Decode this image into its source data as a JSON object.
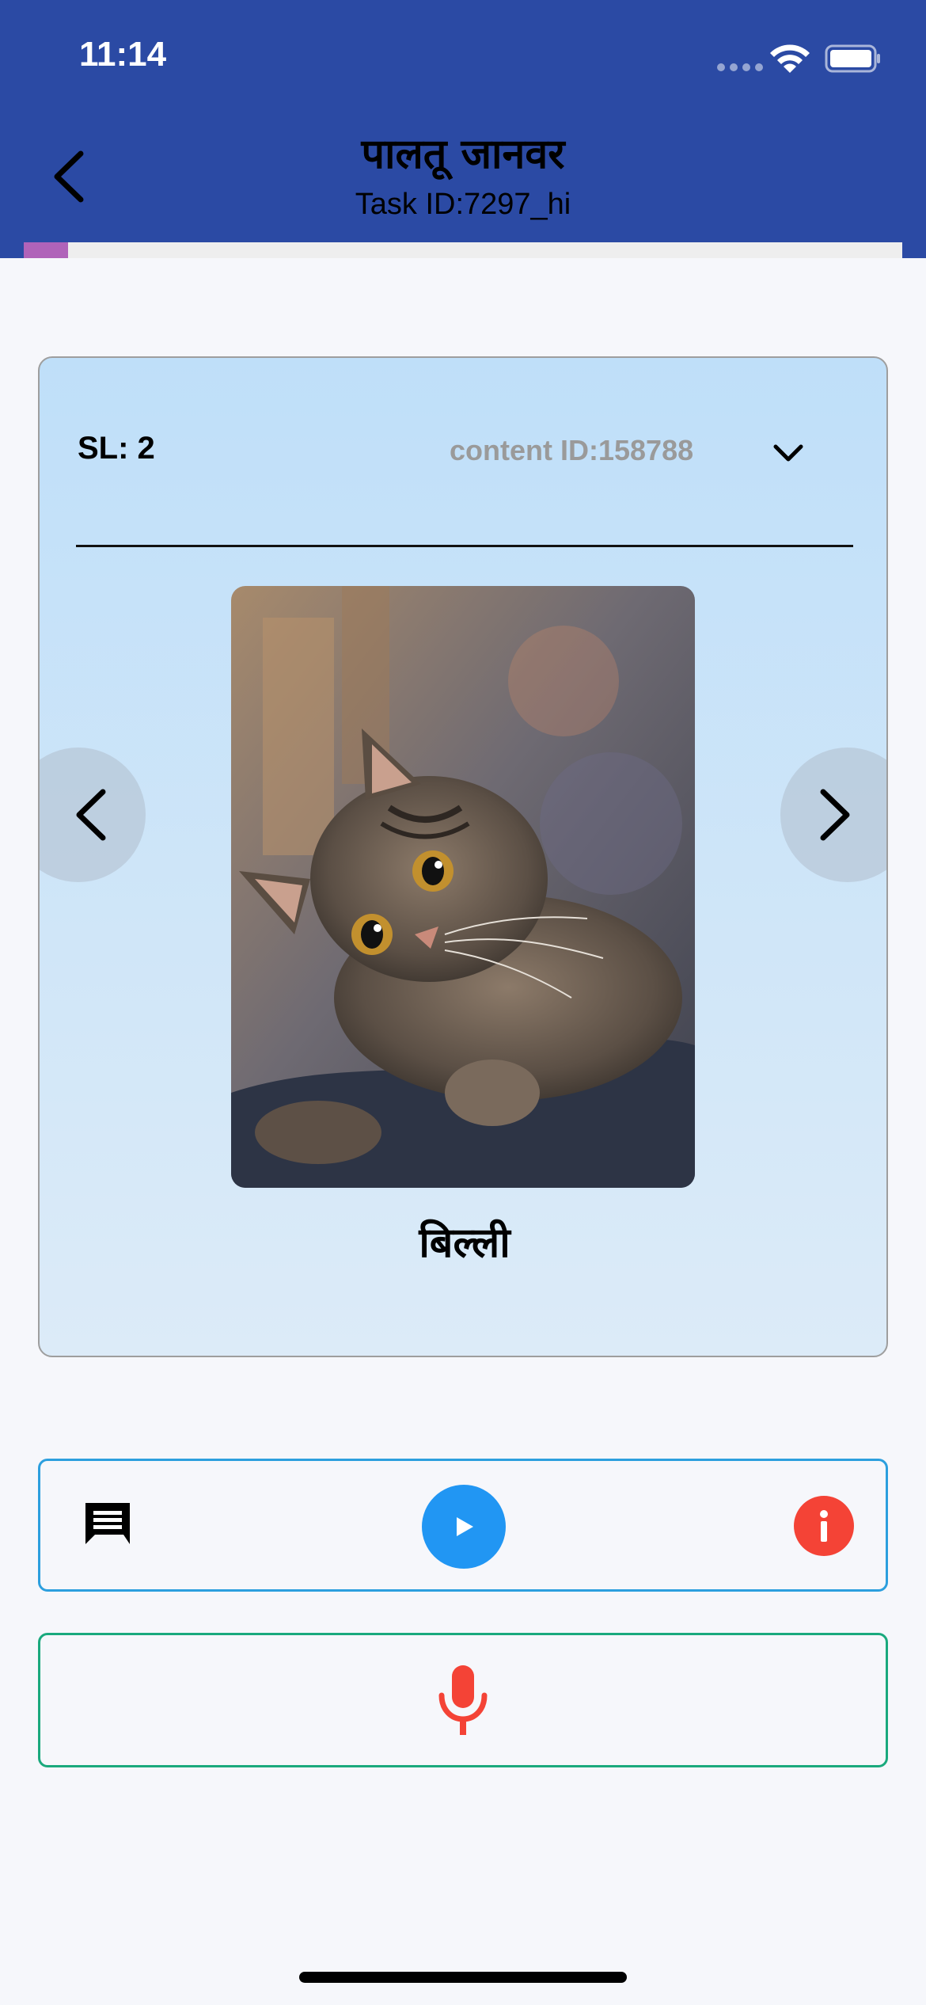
{
  "status_bar": {
    "time": "11:14"
  },
  "header": {
    "title": "पालतू जानवर",
    "subtitle": "Task ID:7297_hi",
    "progress_fraction": 0.05
  },
  "card": {
    "sl_label": "SL: 2",
    "content_id": "content ID:158788",
    "word": "बिल्ली",
    "image_icon": "cat-photo"
  },
  "actions": {
    "chat_icon": "chat-icon",
    "play_icon": "play-icon",
    "info_icon": "info-icon"
  },
  "record": {
    "mic_icon": "microphone-icon"
  },
  "colors": {
    "header_bg": "#2b4aa4",
    "progress": "#b063b9",
    "play": "#2196f3",
    "info": "#f44336",
    "mic": "#f44336",
    "action_border": "#2c9fde",
    "record_border": "#1aa97d"
  }
}
